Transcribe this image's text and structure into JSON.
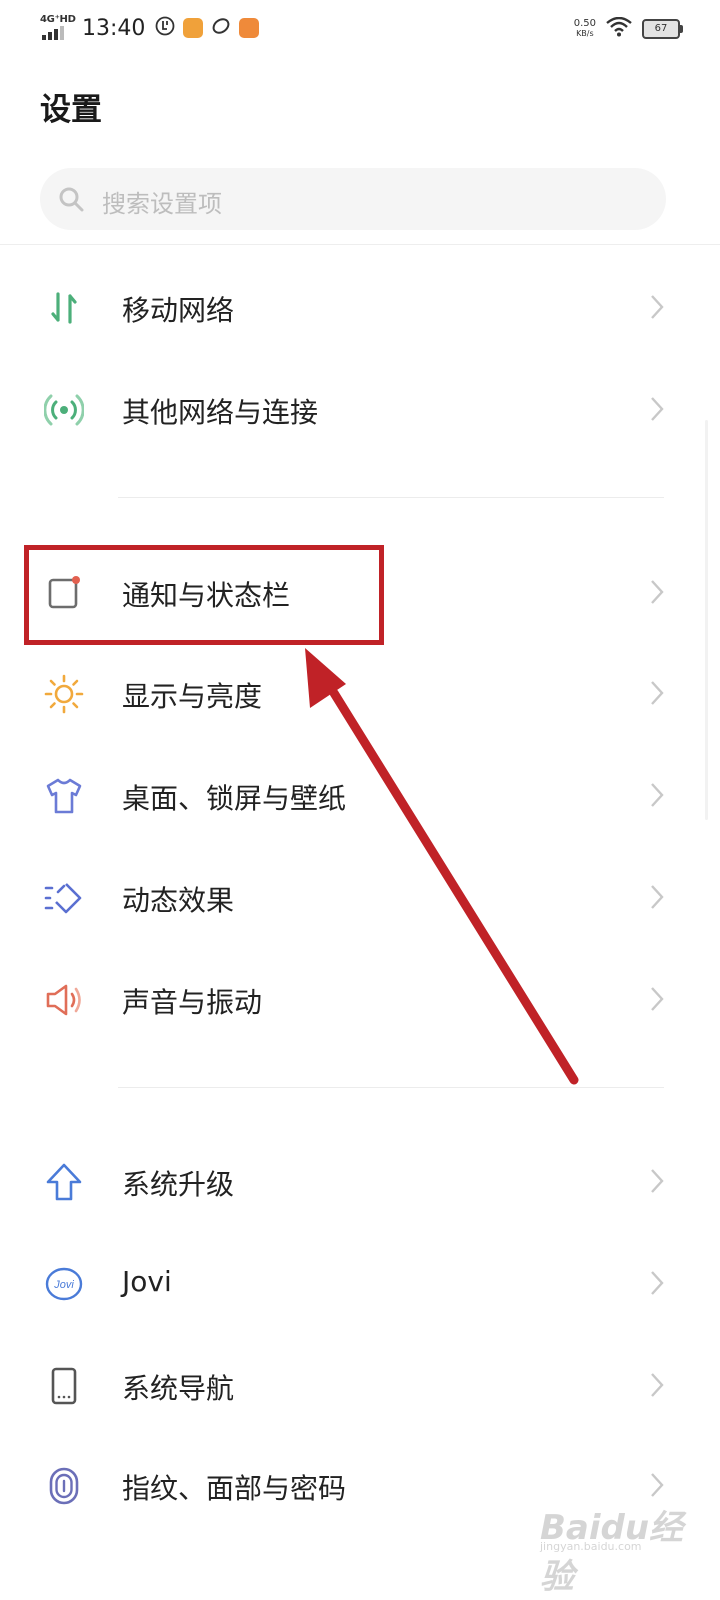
{
  "status_bar": {
    "network": "4G⁺HD",
    "time": "13:40",
    "speed_value": "0.50",
    "speed_unit": "KB/s",
    "battery": "67"
  },
  "header": {
    "title": "设置"
  },
  "search": {
    "placeholder": "搜索设置项"
  },
  "groups": [
    {
      "items": [
        {
          "label": "移动网络",
          "icon": "mobile-data-icon",
          "color": "#4caf7a"
        },
        {
          "label": "其他网络与连接",
          "icon": "connection-icon",
          "color": "#4caf7a"
        }
      ]
    },
    {
      "items": [
        {
          "label": "通知与状态栏",
          "icon": "notification-icon",
          "color": "#6d6d6d"
        },
        {
          "label": "显示与亮度",
          "icon": "sun-icon",
          "color": "#f1a93c"
        },
        {
          "label": "桌面、锁屏与壁纸",
          "icon": "tshirt-icon",
          "color": "#6b7bd6"
        },
        {
          "label": "动态效果",
          "icon": "animation-icon",
          "color": "#5a6fd1"
        },
        {
          "label": "声音与振动",
          "icon": "speaker-icon",
          "color": "#e06e58"
        }
      ]
    },
    {
      "items": [
        {
          "label": "系统升级",
          "icon": "upgrade-arrow-icon",
          "color": "#4a7bd8"
        },
        {
          "label": "Jovi",
          "icon": "jovi-icon",
          "color": "#4a7bd8"
        },
        {
          "label": "系统导航",
          "icon": "phone-icon",
          "color": "#555555"
        },
        {
          "label": "指纹、面部与密码",
          "icon": "fingerprint-icon",
          "color": "#6b6fb8"
        }
      ]
    }
  ],
  "annotation": {
    "color": "#c02227"
  },
  "watermark": {
    "brand": "Baidu经验",
    "url": "jingyan.baidu.com"
  }
}
